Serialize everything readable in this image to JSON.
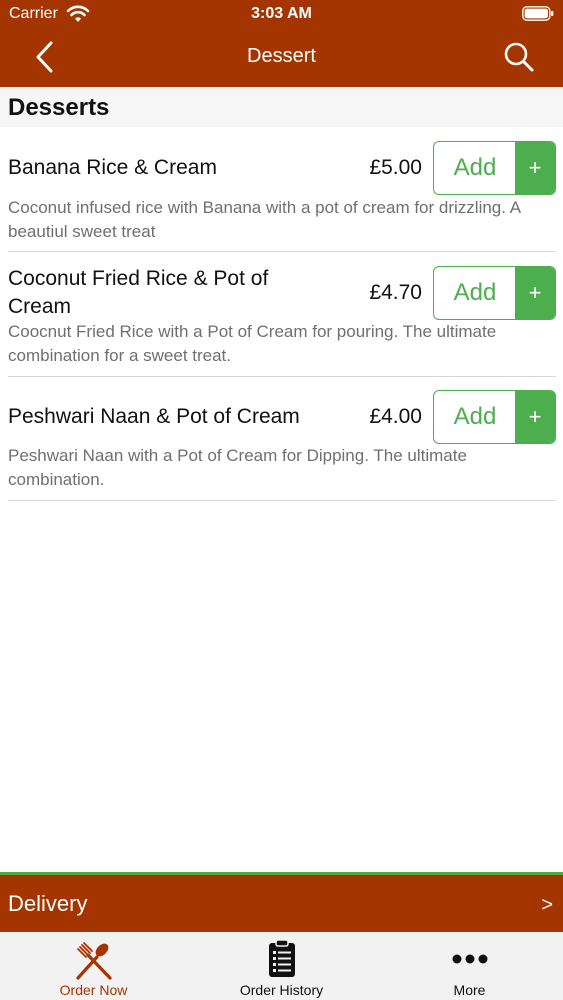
{
  "status_bar": {
    "carrier": "Carrier",
    "time": "3:03 AM"
  },
  "nav": {
    "title": "Dessert"
  },
  "section": {
    "title": "Desserts"
  },
  "items": [
    {
      "name": "Banana Rice & Cream",
      "price": "£5.00",
      "description": "Coconut infused rice with Banana with a pot of cream for drizzling. A beautiul sweet treat",
      "add_label": "Add",
      "plus_label": "+"
    },
    {
      "name": "Coconut Fried Rice & Pot of Cream",
      "price": "£4.70",
      "description": "Coocnut Fried Rice with a Pot of Cream for pouring. The ultimate combination for a sweet treat.",
      "add_label": "Add",
      "plus_label": "+"
    },
    {
      "name": "Peshwari Naan & Pot of Cream",
      "price": "£4.00",
      "description": "Peshwari Naan with a Pot of Cream for Dipping. The ultimate combination.",
      "add_label": "Add",
      "plus_label": "+"
    }
  ],
  "delivery": {
    "label": "Delivery",
    "chevron": ">"
  },
  "tabs": [
    {
      "label": "Order Now",
      "icon": "fork-spoon-icon",
      "active": true
    },
    {
      "label": "Order History",
      "icon": "clipboard-list-icon",
      "active": false
    },
    {
      "label": "More",
      "icon": "more-dots-icon",
      "active": false
    }
  ],
  "colors": {
    "brand": "#a43400",
    "accent_green": "#4cae4c",
    "text_muted": "#6f6f6f"
  }
}
